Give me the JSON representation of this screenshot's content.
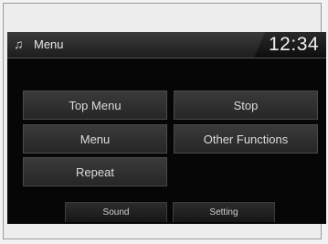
{
  "header": {
    "icon": "music-note-icon",
    "title": "Menu",
    "clock": "12:34"
  },
  "menu": {
    "top_menu": "Top Menu",
    "stop": "Stop",
    "menu": "Menu",
    "other_functions": "Other Functions",
    "repeat": "Repeat"
  },
  "softkeys": {
    "sound": "Sound",
    "setting": "Setting"
  }
}
